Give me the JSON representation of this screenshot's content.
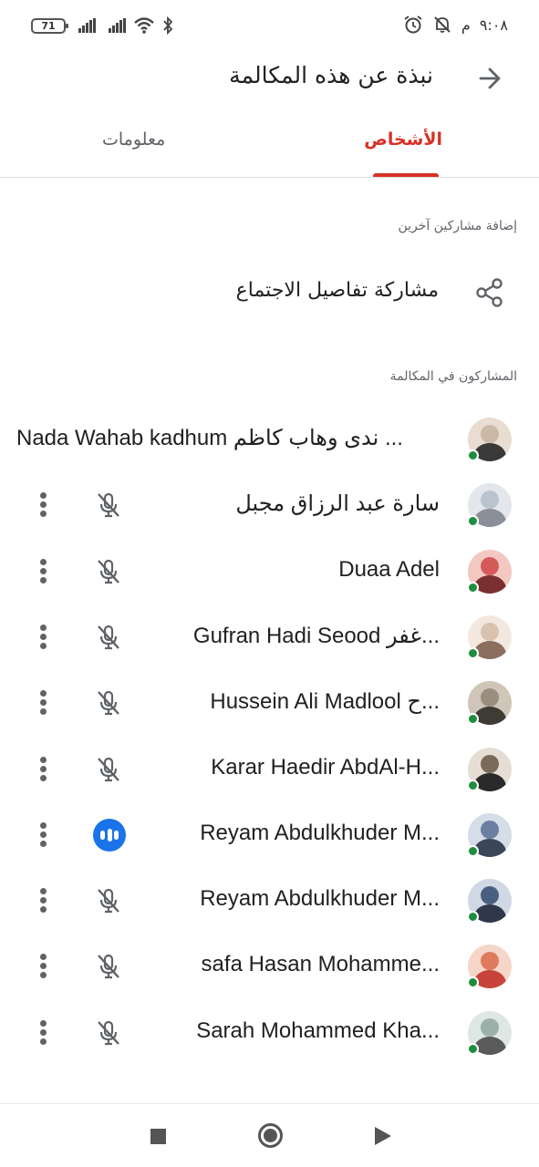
{
  "status_bar": {
    "time": "٩:٠٨",
    "am_pm": "م",
    "battery_level": "71",
    "icons": [
      "battery-icon",
      "signal-icon",
      "signal-icon",
      "wifi-icon",
      "bluetooth-icon",
      "alarm-icon",
      "notifications-off-icon"
    ]
  },
  "header": {
    "title": "نبذة عن هذه المكالمة",
    "back_icon": "arrow-back-icon"
  },
  "tabs": [
    {
      "label": "الأشخاص",
      "selected": true
    },
    {
      "label": "معلومات",
      "selected": false
    }
  ],
  "add_participants": {
    "section_label": "إضافة مشاركين آخرين",
    "share_label": "مشاركة تفاصيل الاجتماع",
    "share_icon": "share-icon"
  },
  "participants_section": {
    "label": "المشاركون في المكالمة",
    "items": [
      {
        "name": "Nada Wahab kadhum ندى وهاب كاظم ...",
        "online": true,
        "mic": "none"
      },
      {
        "name": "سارة عبد الرزاق مجبل",
        "online": true,
        "mic": "muted"
      },
      {
        "name": "Duaa Adel",
        "online": true,
        "mic": "muted"
      },
      {
        "name": "Gufran Hadi Seood غفر...",
        "online": true,
        "mic": "muted"
      },
      {
        "name": "Hussein Ali Madlool ح...",
        "online": true,
        "mic": "muted"
      },
      {
        "name": "Karar Haedir AbdAl-H...",
        "online": true,
        "mic": "muted"
      },
      {
        "name": "Reyam Abdulkhuder M...",
        "online": true,
        "mic": "speaking"
      },
      {
        "name": "Reyam Abdulkhuder M...",
        "online": true,
        "mic": "muted"
      },
      {
        "name": "safa Hasan Mohamme...",
        "online": true,
        "mic": "muted"
      },
      {
        "name": "Sarah Mohammed Kha...",
        "online": true,
        "mic": "muted"
      }
    ]
  },
  "colors": {
    "accent": "#d93025",
    "online": "#1e8e3e",
    "speaking": "#1a73e8",
    "muted_icon": "#5f6368"
  },
  "nav_bar": {
    "icons": [
      "recents-square-icon",
      "home-circle-icon",
      "back-triangle-icon"
    ]
  }
}
